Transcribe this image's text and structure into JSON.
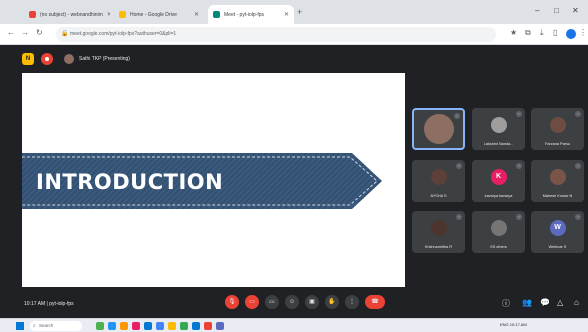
{
  "browser": {
    "tabs": [
      {
        "title": "(no subject) - webnandhinim",
        "active": false,
        "favicon_color": "#ea4335"
      },
      {
        "title": "Home - Google Drive",
        "active": false,
        "favicon_color": "#fbbc04"
      },
      {
        "title": "Meet - pyt-iolp-fps",
        "active": true,
        "favicon_color": "#00897b"
      }
    ],
    "new_tab_icon": "plus-icon",
    "window_controls": [
      "–",
      "□",
      "✕"
    ],
    "url": "meet.google.com/pyt-iolp-fps?authuser=0&pli=1",
    "nav_icons": [
      "←",
      "→",
      "↻"
    ],
    "toolbar_icons": [
      "★",
      "⋮"
    ]
  },
  "meet": {
    "app_badge": "N",
    "presenter_label": "Sathi TKP (Presenting)",
    "slide_title": "INTRODUCTION",
    "participants": [
      {
        "name": "",
        "kind": "video",
        "color": "#8d6e63"
      },
      {
        "name": "Lakshmi Nanda...",
        "kind": "photo",
        "color": "#9e9e9e"
      },
      {
        "name": "Farzana Parsu",
        "kind": "photo",
        "color": "#6d4c41"
      },
      {
        "name": "AYSHA S",
        "kind": "photo",
        "color": "#5d4037"
      },
      {
        "name": "kavarya kavarya",
        "kind": "letter",
        "letter": "K",
        "color": "#e91e63"
      },
      {
        "name": "Mahesh Kumar N",
        "kind": "photo",
        "color": "#795548"
      },
      {
        "name": "Krishnamritha R",
        "kind": "photo",
        "color": "#4e342e"
      },
      {
        "name": "SS others",
        "kind": "photo",
        "color": "#757575"
      },
      {
        "name": "Webinar S",
        "kind": "letter",
        "letter": "W",
        "color": "#5c6bc0"
      }
    ],
    "meeting_info": "10:17 AM | pyt-iolp-fps",
    "controls": [
      {
        "name": "mic-off",
        "glyph": "🎙",
        "red": true
      },
      {
        "name": "camera-off",
        "glyph": "▭",
        "red": true
      },
      {
        "name": "captions",
        "glyph": "CC",
        "red": false
      },
      {
        "name": "emoji",
        "glyph": "☺",
        "red": false
      },
      {
        "name": "present",
        "glyph": "▣",
        "red": false
      },
      {
        "name": "raise-hand",
        "glyph": "✋",
        "red": false
      },
      {
        "name": "more-options",
        "glyph": "⋮",
        "red": false
      },
      {
        "name": "leave-call",
        "glyph": "☎",
        "red": true
      }
    ],
    "right_icons": [
      "ⓘ",
      "👥",
      "💬",
      "△",
      "⌂"
    ]
  },
  "taskbar": {
    "search_placeholder": "Search",
    "apps": [
      "#4caf50",
      "#2196f3",
      "#ff9800",
      "#e91e63",
      "#0078d4",
      "#4285f4",
      "#fbbc04",
      "#34a853"
    ],
    "tray_text": "ENG  10:17  AM"
  },
  "colors": {
    "meet_bg": "#202124",
    "tile_bg": "#3c4043",
    "danger": "#ea4335",
    "denim": "#3b5a80"
  }
}
